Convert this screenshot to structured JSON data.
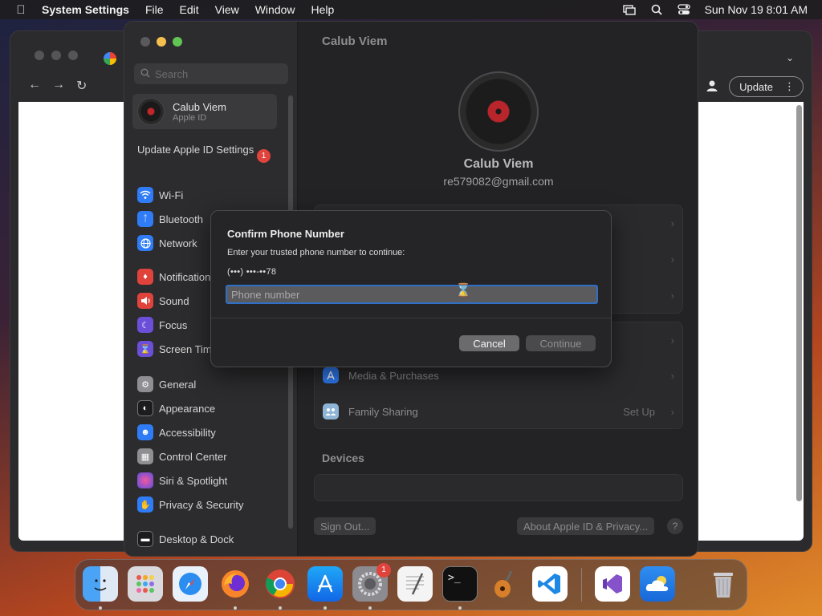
{
  "menubar": {
    "app_name": "System Settings",
    "menus": [
      "File",
      "Edit",
      "View",
      "Window",
      "Help"
    ],
    "datetime": "Sun Nov 19  8:01 AM"
  },
  "chrome": {
    "update_label": "Update"
  },
  "sidebar": {
    "search_placeholder": "Search",
    "account_name": "Calub Viem",
    "account_sub": "Apple ID",
    "update_item": "Update Apple ID Settings",
    "update_badge": "1",
    "items": [
      {
        "label": "Wi-Fi",
        "icon": "wifi-icon",
        "color": "#2f7cf6"
      },
      {
        "label": "Bluetooth",
        "icon": "bluetooth-icon",
        "color": "#2f7cf6"
      },
      {
        "label": "Network",
        "icon": "globe-icon",
        "color": "#2f7cf6"
      },
      {
        "label": "Notifications",
        "icon": "bell-icon",
        "color": "#e0433c"
      },
      {
        "label": "Sound",
        "icon": "speaker-icon",
        "color": "#e0433c"
      },
      {
        "label": "Focus",
        "icon": "moon-icon",
        "color": "#6b4fd8"
      },
      {
        "label": "Screen Time",
        "icon": "hourglass-icon",
        "color": "#6b4fd8"
      },
      {
        "label": "General",
        "icon": "gear-icon",
        "color": "#8e8e93"
      },
      {
        "label": "Appearance",
        "icon": "appearance-icon",
        "color": "#2c2c2e"
      },
      {
        "label": "Accessibility",
        "icon": "accessibility-icon",
        "color": "#2f7cf6"
      },
      {
        "label": "Control Center",
        "icon": "control-center-icon",
        "color": "#8e8e93"
      },
      {
        "label": "Siri & Spotlight",
        "icon": "siri-icon",
        "color": "#b43fd6"
      },
      {
        "label": "Privacy & Security",
        "icon": "hand-icon",
        "color": "#2f7cf6"
      },
      {
        "label": "Desktop & Dock",
        "icon": "dock-icon",
        "color": "#1c1c1e"
      }
    ]
  },
  "main": {
    "title": "Calub Viem",
    "profile_name": "Calub Viem",
    "profile_email": "re579082@gmail.com",
    "rows": [
      {
        "label": "Media & Purchases",
        "value": ""
      },
      {
        "label": "Family Sharing",
        "value": "Set Up"
      }
    ],
    "devices_label": "Devices",
    "sign_out_label": "Sign Out...",
    "about_label": "About Apple ID & Privacy...",
    "help_label": "?"
  },
  "dialog": {
    "title": "Confirm Phone Number",
    "message": "Enter your trusted phone number to continue:",
    "masked_number": "(•••) •••-••78",
    "input_placeholder": "Phone number",
    "input_value": "",
    "cancel_label": "Cancel",
    "continue_label": "Continue"
  },
  "dock": {
    "settings_badge": "1",
    "apps": [
      "Finder",
      "Launchpad",
      "Safari",
      "Firefox",
      "Chrome",
      "App Store",
      "System Settings",
      "TextEdit",
      "Terminal",
      "GarageBand",
      "VS Code",
      "Visual Studio",
      "Weather",
      "Trash"
    ]
  }
}
